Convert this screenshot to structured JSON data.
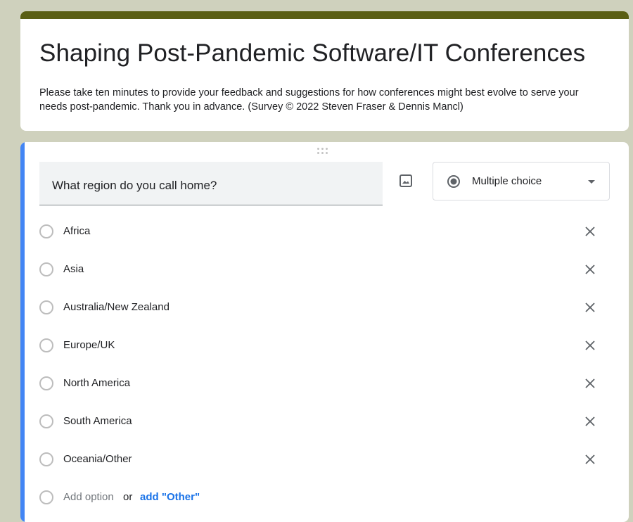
{
  "header": {
    "title": "Shaping Post-Pandemic Software/IT Conferences",
    "description": "Please take ten minutes to provide your feedback and suggestions for how conferences might best evolve to serve your needs post-pandemic.  Thank you in advance. (Survey © 2022 Steven Fraser & Dennis Mancl)",
    "accent_color": "#5a5e14"
  },
  "question": {
    "text": "What region do you call home?",
    "type_label": "Multiple choice",
    "image_icon": "image-icon",
    "active_color": "#4285f4"
  },
  "options": [
    {
      "label": "Africa"
    },
    {
      "label": "Asia"
    },
    {
      "label": "Australia/New Zealand"
    },
    {
      "label": "Europe/UK"
    },
    {
      "label": "North America"
    },
    {
      "label": "South America"
    },
    {
      "label": "Oceania/Other"
    }
  ],
  "add_row": {
    "add_option_label": "Add option",
    "or_label": "or",
    "add_other_label": "add \"Other\""
  }
}
